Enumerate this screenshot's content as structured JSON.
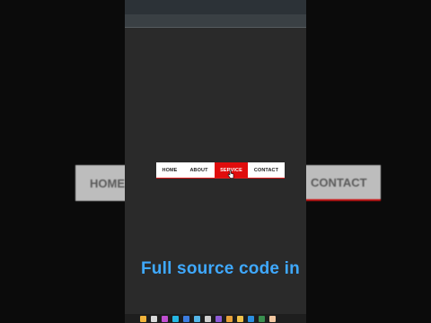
{
  "background_nav": {
    "left_label": "HOME",
    "right_label": "CONTACT"
  },
  "nav": {
    "items": [
      {
        "label": "HOME",
        "active": false
      },
      {
        "label": "ABOUT",
        "active": false
      },
      {
        "label": "SERVICE",
        "active": true
      },
      {
        "label": "CONTACT",
        "active": false
      }
    ],
    "active_color": "#e00d0d"
  },
  "caption": {
    "text": "Full source code in d"
  },
  "taskbar": {
    "icons": [
      {
        "name": "search-icon",
        "color": "#f2b43b"
      },
      {
        "name": "file-icon",
        "color": "#d9d9d9"
      },
      {
        "name": "app-icon",
        "color": "#c04fd0"
      },
      {
        "name": "browser-icon",
        "color": "#26b7e3"
      },
      {
        "name": "app-icon",
        "color": "#3c7de0"
      },
      {
        "name": "app-icon",
        "color": "#55b6e8"
      },
      {
        "name": "app-icon",
        "color": "#cfcfcf"
      },
      {
        "name": "app-icon",
        "color": "#8e5bd6"
      },
      {
        "name": "app-icon",
        "color": "#e7a13a"
      },
      {
        "name": "folder-icon",
        "color": "#f0c24b"
      },
      {
        "name": "code-icon",
        "color": "#2b8fe0"
      },
      {
        "name": "app-icon",
        "color": "#3a8f4f"
      },
      {
        "name": "app-icon",
        "color": "#f1c6a0"
      }
    ]
  }
}
